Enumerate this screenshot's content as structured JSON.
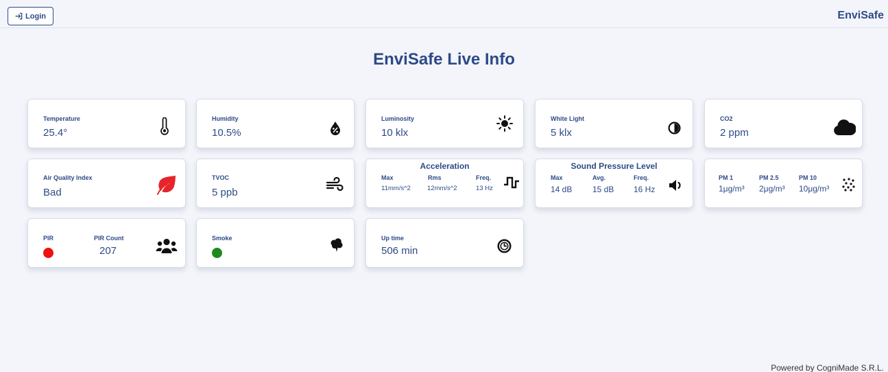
{
  "navbar": {
    "login_label": "Login",
    "brand": "EnviSafe"
  },
  "page": {
    "title": "EnviSafe Live Info"
  },
  "cards": {
    "temperature": {
      "label": "Temperature",
      "value": "25.4°",
      "icon": "thermometer-icon"
    },
    "humidity": {
      "label": "Humidity",
      "value": "10.5%",
      "icon": "droplet-percent-icon"
    },
    "luminosity": {
      "label": "Luminosity",
      "value": "10 klx",
      "icon": "sun-icon"
    },
    "white_light": {
      "label": "White Light",
      "value": "5 klx",
      "icon": "contrast-icon"
    },
    "co2": {
      "label": "CO2",
      "value": "2 ppm",
      "icon": "cloud-icon"
    },
    "air_quality": {
      "label": "Air Quality Index",
      "value": "Bad",
      "icon": "leaf-icon",
      "icon_color": "#e8242b"
    },
    "tvoc": {
      "label": "TVOC",
      "value": "5 ppb",
      "icon": "wind-icon"
    },
    "acceleration": {
      "title": "Acceleration",
      "max_label": "Max",
      "max_value": "11mm/s^2",
      "rms_label": "Rms",
      "rms_value": "12mm/s^2",
      "freq_label": "Freq.",
      "freq_value": "13 Hz",
      "icon": "square-wave-icon"
    },
    "sound": {
      "title": "Sound Pressure Level",
      "max_label": "Max",
      "max_value": "14 dB",
      "avg_label": "Avg.",
      "avg_value": "15 dB",
      "freq_label": "Freq.",
      "freq_value": "16 Hz",
      "icon": "volume-icon"
    },
    "pm": {
      "pm1_label": "PM 1",
      "pm1_value": "1μg/m³",
      "pm25_label": "PM 2.5",
      "pm25_value": "2μg/m³",
      "pm10_label": "PM 10",
      "pm10_value": "10μg/m³",
      "icon": "particles-icon"
    },
    "pir": {
      "label": "PIR",
      "status_color": "#ee1111",
      "count_label": "PIR Count",
      "count_value": "207",
      "icon": "people-group-icon"
    },
    "smoke": {
      "label": "Smoke",
      "status_color": "#1e8a1e",
      "icon": "smoke-icon"
    },
    "uptime": {
      "label": "Up time",
      "value": "506 min",
      "icon": "clock-icon"
    }
  },
  "footer": {
    "text": "Powered by CogniMade S.R.L."
  }
}
